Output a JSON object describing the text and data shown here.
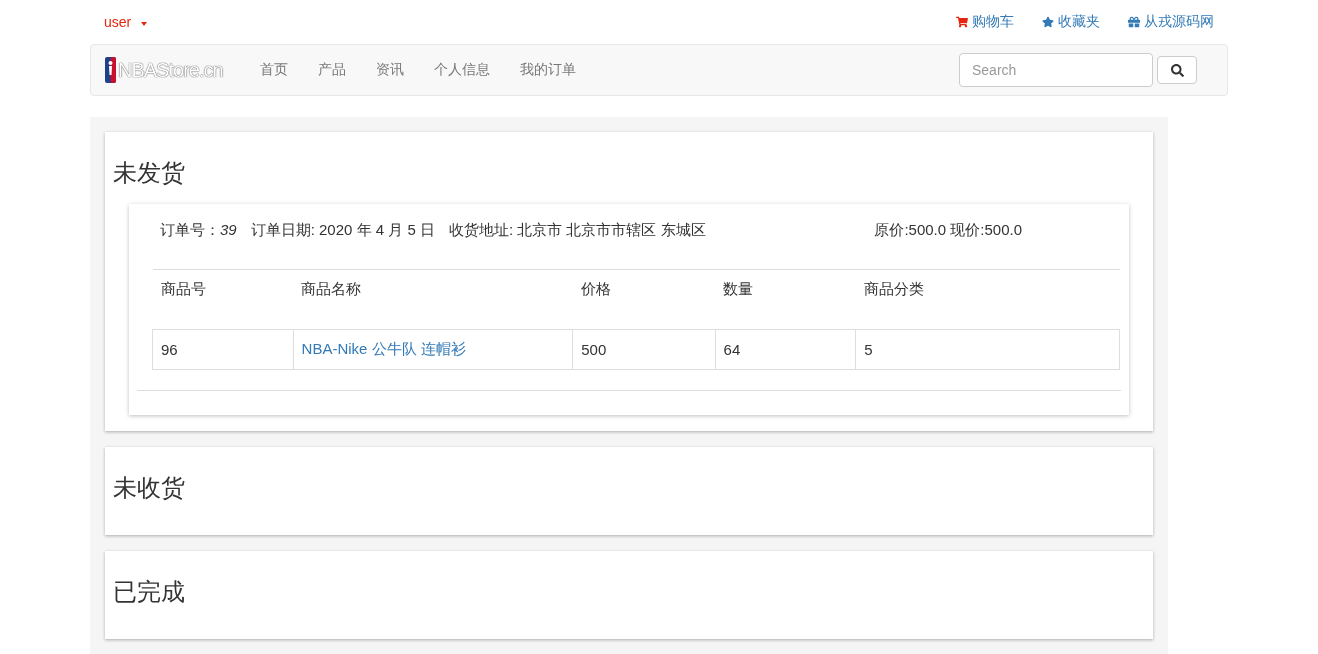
{
  "top_bar": {
    "user": "user",
    "links": [
      {
        "kind": "cart",
        "label": "购物车"
      },
      {
        "kind": "star",
        "label": "收藏夹"
      },
      {
        "kind": "gift",
        "label": "从戎源码网"
      }
    ]
  },
  "navbar": {
    "brand": "NBAStore.cn",
    "items": [
      "首页",
      "产品",
      "资讯",
      "个人信息",
      "我的订单"
    ],
    "search": {
      "placeholder": "Search"
    }
  },
  "sections": [
    {
      "title": "未发货",
      "orders": [
        {
          "number": "订单号：*39*",
          "date": "订单日期: 2020 年 4 月 5 日",
          "address": "收货地址: 北京市 北京市市辖区 东城区",
          "price": "原价:500.0 现价:500.0",
          "columns": [
            "商品号",
            "商品名称",
            "价格",
            "数量",
            "商品分类"
          ],
          "rows": [
            {
              "id": "96",
              "name": "NBA-Nike 公牛队 连帽衫",
              "price": "500",
              "quantity": "64",
              "category": "5"
            }
          ]
        }
      ]
    },
    {
      "title": "未收货"
    },
    {
      "title": "已完成"
    }
  ]
}
